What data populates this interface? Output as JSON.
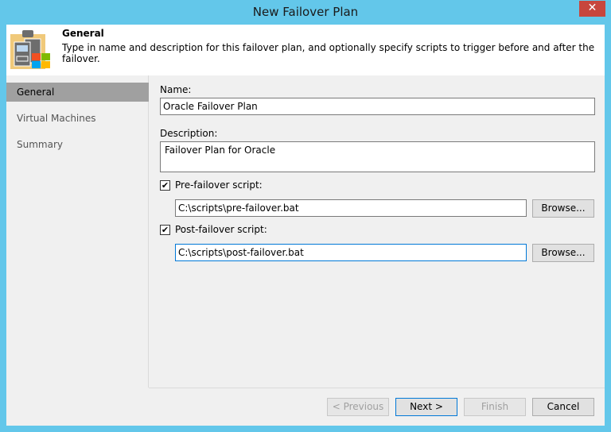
{
  "window": {
    "title": "New Failover Plan",
    "close": "✕"
  },
  "header": {
    "title": "General",
    "description": "Type in name and description for this failover plan, and optionally specify scripts to trigger before and after the failover."
  },
  "nav": [
    {
      "label": "General",
      "selected": true
    },
    {
      "label": "Virtual Machines"
    },
    {
      "label": "Summary"
    }
  ],
  "form": {
    "name_label": "Name:",
    "name_value": "Oracle Failover Plan",
    "description_label": "Description:",
    "description_value": "Failover Plan for Oracle",
    "pre_label": "Pre-failover script:",
    "pre_checked": true,
    "pre_value": "C:\\scripts\\pre-failover.bat",
    "post_label": "Post-failover script:",
    "post_checked": true,
    "post_value": "C:\\scripts\\post-failover.bat",
    "browse": "Browse..."
  },
  "buttons": {
    "previous": "< Previous",
    "next": "Next >",
    "finish": "Finish",
    "cancel": "Cancel"
  }
}
